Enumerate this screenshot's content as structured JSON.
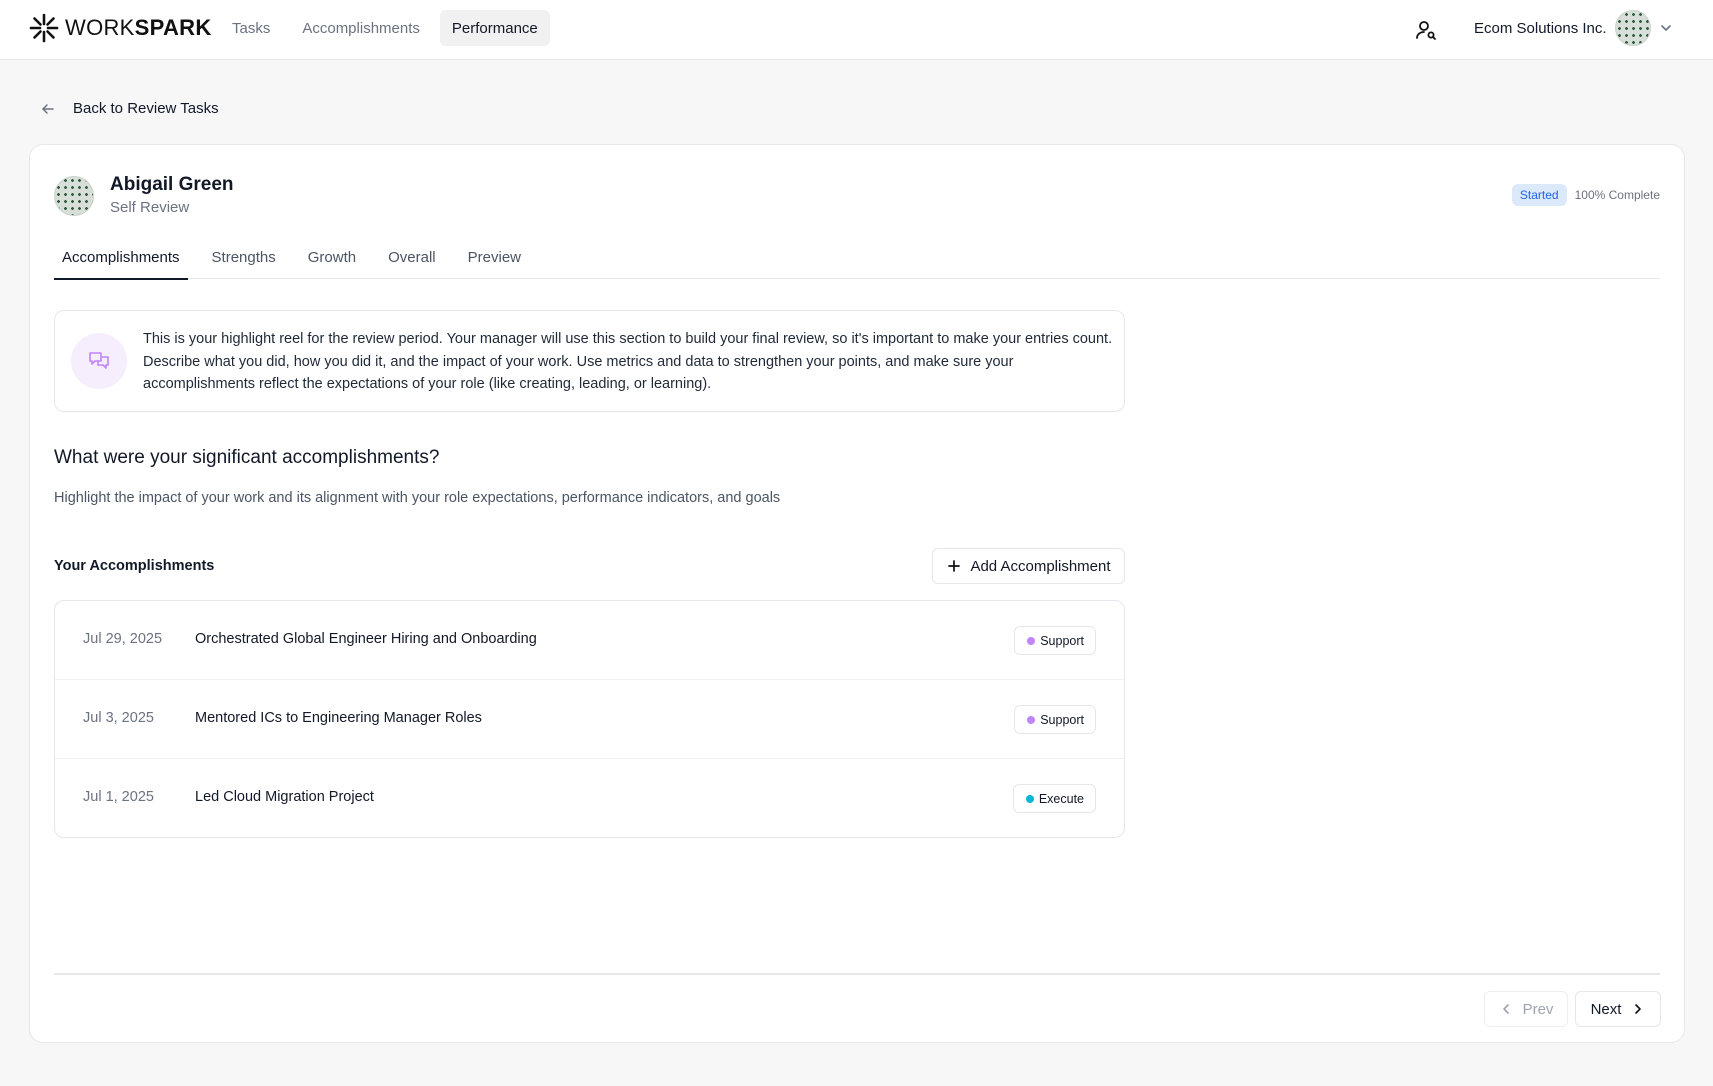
{
  "brand": {
    "light": "WORK",
    "bold": "SPARK"
  },
  "nav": {
    "items": [
      {
        "label": "Tasks"
      },
      {
        "label": "Accomplishments"
      },
      {
        "label": "Performance"
      }
    ],
    "active": "Performance"
  },
  "header": {
    "org_name": "Ecom Solutions Inc."
  },
  "back_link": {
    "label": "Back to Review Tasks"
  },
  "review": {
    "person_name": "Abigail Green",
    "review_type": "Self Review",
    "status": "Started",
    "progress_label": "100% Complete",
    "progress_percent": 100
  },
  "tabs": [
    {
      "label": "Accomplishments"
    },
    {
      "label": "Strengths"
    },
    {
      "label": "Growth"
    },
    {
      "label": "Overall"
    },
    {
      "label": "Preview"
    }
  ],
  "info": {
    "text": "This is your highlight reel for the review period. Your manager will use this section to build your final review, so it's important to make your entries count. Describe what you did, how you did it, and the impact of your work. Use metrics and data to strengthen your points, and make sure your accomplishments reflect the expectations of your role (like creating, leading, or learning)."
  },
  "question": {
    "title": "What were your significant accomplishments?",
    "subtitle": "Highlight the impact of your work and its alignment with your role expectations, performance indicators, and goals"
  },
  "accomplishments": {
    "heading": "Your Accomplishments",
    "add_label": "Add Accomplishment",
    "items": [
      {
        "date": "Jul 29, 2025",
        "title": "Orchestrated Global Engineer Hiring and Onboarding",
        "tag": "Support",
        "tag_color": "#c084fc"
      },
      {
        "date": "Jul 3, 2025",
        "title": "Mentored ICs to Engineering Manager Roles",
        "tag": "Support",
        "tag_color": "#c084fc"
      },
      {
        "date": "Jul 1, 2025",
        "title": "Led Cloud Migration Project",
        "tag": "Execute",
        "tag_color": "#06b6d4"
      }
    ]
  },
  "pager": {
    "prev_label": "Prev",
    "next_label": "Next"
  },
  "colors": {
    "accent": "#111827",
    "started_bg": "#dbe9fb",
    "started_text": "#2563eb",
    "info_icon_bg": "#f6eefc",
    "info_icon": "#c084fc"
  }
}
